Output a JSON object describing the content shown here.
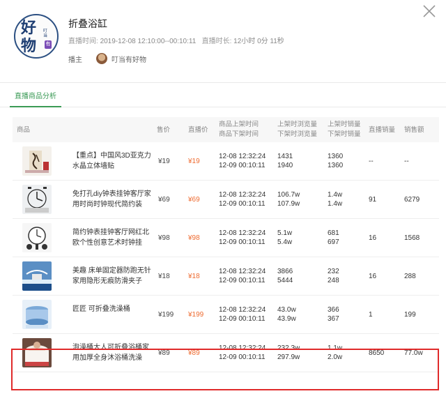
{
  "header": {
    "logo_line1": "好",
    "logo_line2": "物",
    "logo_side": "叮当",
    "logo_tag": "有",
    "title": "折叠浴缸",
    "live_time_label": "直播时间:",
    "live_time_value": "2019-12-08 12:10:00--00:10:11",
    "duration_label": "直播时长:",
    "duration_value": "12小时 0分 11秒",
    "host_label": "播主",
    "host_name": "叮当有好物"
  },
  "tabs": [
    {
      "label": "直播商品分析",
      "active": true
    }
  ],
  "table": {
    "headers": {
      "product": "商品",
      "price": "售价",
      "live_price": "直播价",
      "time_on": "商品上架时间",
      "time_off": "商品下架时间",
      "views_on": "上架时浏览量",
      "views_off": "下架时浏览量",
      "sales_on": "上架时销量",
      "sales_off": "下架时销量",
      "live_sales": "直播销量",
      "amount": "销售额"
    },
    "rows": [
      {
        "name": "【重点】中国风3D亚克力水晶立体墙贴",
        "price": "¥19",
        "live_price": "¥19",
        "time_on": "12-08 12:32:24",
        "time_off": "12-09 00:10:11",
        "views_on": "1431",
        "views_off": "1940",
        "sales_on": "1360",
        "sales_off": "1360",
        "live_sales": "--",
        "amount": "--",
        "thumb": "calligraphy"
      },
      {
        "name": "免打孔diy钟表挂钟客厅家用时尚时钟现代简约装饰...",
        "price": "¥69",
        "live_price": "¥69",
        "time_on": "12-08 12:32:24",
        "time_off": "12-09 00:10:11",
        "views_on": "106.7w",
        "views_off": "107.9w",
        "sales_on": "1.4w",
        "sales_off": "1.4w",
        "live_sales": "91",
        "amount": "6279",
        "thumb": "clock-diy"
      },
      {
        "name": "简约钟表挂钟客厅网红北欧个性创意艺术时钟挂墙...",
        "price": "¥98",
        "live_price": "¥98",
        "time_on": "12-08 12:32:24",
        "time_off": "12-09 00:10:11",
        "views_on": "5.1w",
        "views_off": "5.4w",
        "sales_on": "681",
        "sales_off": "697",
        "live_sales": "16",
        "amount": "1568",
        "thumb": "clock-nordic"
      },
      {
        "name": "美趣 床单固定器防跑无针家用隐形无痕防滑夹子床...",
        "price": "¥18",
        "live_price": "¥18",
        "time_on": "12-08 12:32:24",
        "time_off": "12-09 00:10:11",
        "views_on": "3866",
        "views_off": "5444",
        "sales_on": "232",
        "sales_off": "248",
        "live_sales": "16",
        "amount": "288",
        "thumb": "clip"
      },
      {
        "name": "匠匠 可折叠洗澡桶",
        "price": "¥199",
        "live_price": "¥199",
        "time_on": "12-08 12:32:24",
        "time_off": "12-09 00:10:11",
        "views_on": "43.0w",
        "views_off": "43.9w",
        "sales_on": "366",
        "sales_off": "367",
        "live_sales": "1",
        "amount": "199",
        "thumb": "tub-blue"
      },
      {
        "name": "泡澡桶大人可折叠浴桶家用加厚全身沐浴桶洗澡桶...",
        "price": "¥89",
        "live_price": "¥89",
        "time_on": "12-08 12:32:24",
        "time_off": "12-09 00:10:11",
        "views_on": "232.3w",
        "views_off": "297.9w",
        "sales_on": "1.1w",
        "sales_off": "2.0w",
        "live_sales": "8650",
        "amount": "77.0w",
        "thumb": "tub-person",
        "highlighted": true
      }
    ]
  },
  "colors": {
    "accent_green": "#3a9a55",
    "price_orange": "#ee6a2f",
    "highlight_red": "#e02a2a"
  },
  "icons": {
    "close": "close-icon"
  }
}
